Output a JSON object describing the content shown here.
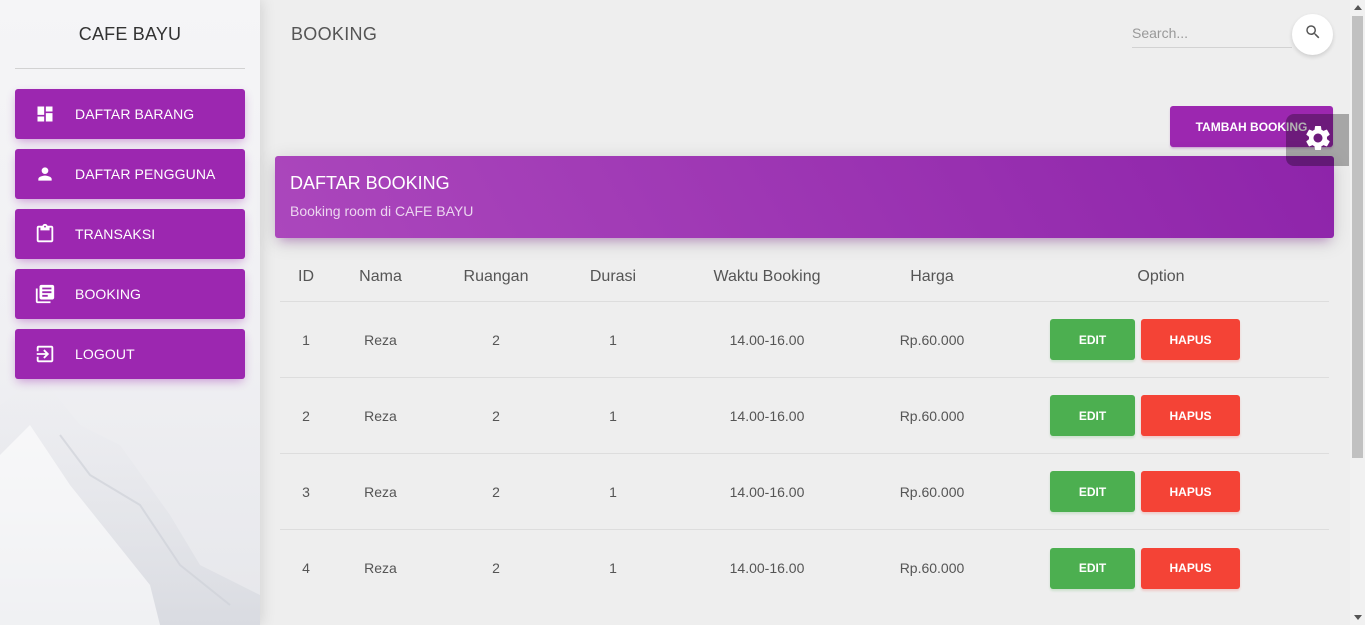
{
  "sidebar": {
    "brand": "CAFE BAYU",
    "items": [
      {
        "label": "DAFTAR BARANG",
        "icon": "dashboard-icon"
      },
      {
        "label": "DAFTAR PENGGUNA",
        "icon": "person-icon"
      },
      {
        "label": "TRANSAKSI",
        "icon": "clipboard-icon"
      },
      {
        "label": "BOOKING",
        "icon": "library-books-icon"
      },
      {
        "label": "LOGOUT",
        "icon": "logout-icon"
      }
    ]
  },
  "header": {
    "title": "BOOKING",
    "search_placeholder": "Search...",
    "search_icon": "search-icon"
  },
  "toolbar": {
    "add_label": "TAMBAH BOOKING"
  },
  "card": {
    "title": "DAFTAR BOOKING",
    "subtitle": "Booking room di CAFE BAYU"
  },
  "table": {
    "headers": [
      "ID",
      "Nama",
      "Ruangan",
      "Durasi",
      "Waktu Booking",
      "Harga",
      "Option"
    ],
    "rows": [
      {
        "id": "1",
        "nama": "Reza",
        "ruangan": "2",
        "durasi": "1",
        "waktu": "14.00-16.00",
        "harga": "Rp.60.000"
      },
      {
        "id": "2",
        "nama": "Reza",
        "ruangan": "2",
        "durasi": "1",
        "waktu": "14.00-16.00",
        "harga": "Rp.60.000"
      },
      {
        "id": "3",
        "nama": "Reza",
        "ruangan": "2",
        "durasi": "1",
        "waktu": "14.00-16.00",
        "harga": "Rp.60.000"
      },
      {
        "id": "4",
        "nama": "Reza",
        "ruangan": "2",
        "durasi": "1",
        "waktu": "14.00-16.00",
        "harga": "Rp.60.000"
      }
    ],
    "edit_label": "EDIT",
    "delete_label": "HAPUS"
  },
  "colors": {
    "primary": "#9c27b0",
    "success": "#4caf50",
    "danger": "#f44336"
  }
}
